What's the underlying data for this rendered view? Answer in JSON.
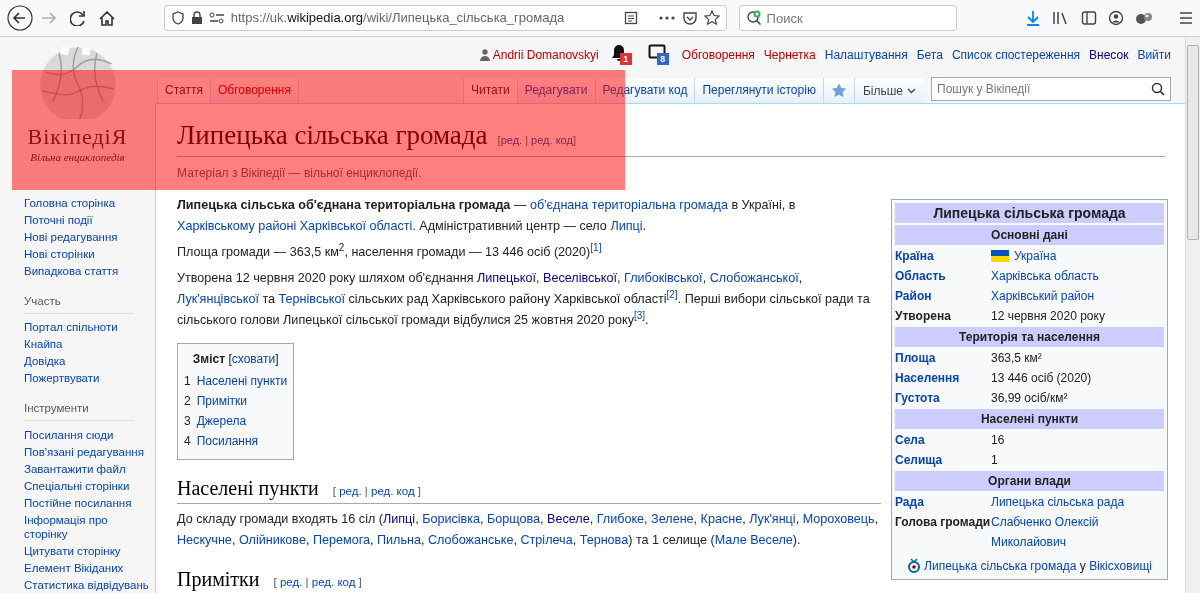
{
  "annotation": {
    "kind": "highlight"
  },
  "browser": {
    "nav": [
      {
        "kind": "back",
        "disabled": false
      },
      {
        "kind": "forward",
        "disabled": true
      },
      {
        "kind": "reload",
        "disabled": false
      },
      {
        "kind": "home",
        "disabled": false
      }
    ],
    "url": {
      "prefix": "https://uk.",
      "domain": "wikipedia.org",
      "path": "/wiki/Липецька_сільська_громада"
    },
    "search": {
      "placeholder": "Поиск"
    }
  },
  "user_bar": {
    "user": {
      "text": "Andrii Domanovskyi",
      "kind": "new"
    },
    "notifications": [
      {
        "kind": "bell",
        "badge": "1",
        "color": "#dd3333"
      },
      {
        "kind": "tray",
        "badge": "8",
        "color": "#3366cc"
      }
    ],
    "links": [
      {
        "text": "Обговорення",
        "kind": "new"
      },
      {
        "text": "Чернетка",
        "kind": "new"
      },
      {
        "text": "Налаштування",
        "kind": "link"
      },
      {
        "text": "Бета",
        "kind": "link"
      },
      {
        "text": "Список спостереження",
        "kind": "link"
      },
      {
        "text": "Внесок",
        "kind": "visited"
      },
      {
        "text": "Вийти",
        "kind": "link"
      }
    ]
  },
  "logo": {
    "name": "ВікіпедіЯ",
    "tagline": "Вільна енциклопедія"
  },
  "tabs_left": [
    {
      "label": "Стаття",
      "kind": "link",
      "selected": true
    },
    {
      "label": "Обговорення",
      "kind": "new",
      "selected": false
    }
  ],
  "tabs_right": [
    {
      "label": "Читати",
      "selected": true
    },
    {
      "label": "Редагувати",
      "selected": false
    },
    {
      "label": "Редагувати код",
      "selected": false
    },
    {
      "label": "Переглянути історію",
      "selected": false
    }
  ],
  "watch": {
    "watched": true
  },
  "more": {
    "label": "Більше"
  },
  "wiki_search": {
    "placeholder": "Пошук у Вікіпедії"
  },
  "sidebar": {
    "groups": [
      {
        "items": [
          "Головна сторінка",
          "Поточні події",
          "Нові редагування",
          "Нові сторінки",
          "Випадкова стаття"
        ]
      },
      {
        "heading": "Участь",
        "items": [
          "Портал спільноти",
          "Кнайпа",
          "Довідка",
          "Пожертвувати"
        ]
      },
      {
        "heading": "Інструменти",
        "items": [
          "Посилання сюди",
          "Пов'язані редагування",
          "Завантажити файл",
          "Спеціальні сторінки",
          "Постійне посилання",
          "Інформація про сторінку",
          "Цитувати сторінку",
          "Елемент Вікіданих",
          "Статистика відвідувань"
        ]
      }
    ]
  },
  "article": {
    "title": "Липецька сільська громада",
    "edit_links": [
      {
        "text": "[",
        "kind": "text"
      },
      {
        "text": "ред.",
        "kind": "link"
      },
      {
        "text": " | ",
        "kind": "text"
      },
      {
        "text": "ред. код",
        "kind": "link"
      },
      {
        "text": "]",
        "kind": "text"
      }
    ],
    "subtitle": "Матеріал з Вікіпедії — вільної енциклопедії.",
    "paragraphs": [
      [
        {
          "text": "Липецька сільська об'єднана територіальна громада",
          "kind": "bold"
        },
        {
          "text": " — ",
          "kind": "text"
        },
        {
          "text": "об'єднана територіальна громада",
          "kind": "link"
        },
        {
          "text": " в Україні, в ",
          "kind": "text"
        },
        {
          "text": "Харківському районі Харківської області",
          "kind": "link"
        },
        {
          "text": ". Адміністративний центр — село ",
          "kind": "text"
        },
        {
          "text": "Липці",
          "kind": "link"
        },
        {
          "text": ".",
          "kind": "text"
        }
      ],
      [
        {
          "text": "Площа громади — 363,5 км",
          "kind": "text"
        },
        {
          "text": "2",
          "kind": "sup"
        },
        {
          "text": ", населення громади — 13 446 осіб (2020)",
          "kind": "text"
        },
        {
          "text": "[1]",
          "kind": "ref"
        }
      ],
      [
        {
          "text": "Утворена 12 червня 2020 року шляхом об'єднання ",
          "kind": "text"
        },
        {
          "text": "Липецької",
          "kind": "visited"
        },
        {
          "text": ", ",
          "kind": "text"
        },
        {
          "text": "Веселівської",
          "kind": "visited"
        },
        {
          "text": ", ",
          "kind": "text"
        },
        {
          "text": "Глибоківської",
          "kind": "link"
        },
        {
          "text": ", ",
          "kind": "text"
        },
        {
          "text": "Слобожанської",
          "kind": "link"
        },
        {
          "text": ", ",
          "kind": "text"
        },
        {
          "text": "Лук'янцівської",
          "kind": "link"
        },
        {
          "text": " та ",
          "kind": "text"
        },
        {
          "text": "Тернівської",
          "kind": "link"
        },
        {
          "text": " сільських рад Харківського району Харківської області",
          "kind": "text"
        },
        {
          "text": "[2]",
          "kind": "ref"
        },
        {
          "text": ". Перші вибори сільської ради та сільського голови Липецької сільської громади відбулися 25 жовтня 2020 року",
          "kind": "text"
        },
        {
          "text": "[3]",
          "kind": "ref"
        },
        {
          "text": ".",
          "kind": "text"
        }
      ]
    ],
    "toc": {
      "title": [
        {
          "text": "Зміст",
          "kind": "bold"
        },
        {
          "text": " [",
          "kind": "text"
        },
        {
          "text": "сховати",
          "kind": "link"
        },
        {
          "text": "]",
          "kind": "text"
        }
      ],
      "items": [
        {
          "number": "1",
          "label": "Населені пункти"
        },
        {
          "number": "2",
          "label": "Примітки"
        },
        {
          "number": "3",
          "label": "Джерела"
        },
        {
          "number": "4",
          "label": "Посилання"
        }
      ]
    },
    "sections": [
      {
        "heading": "Населені пункти",
        "edit_links": [
          {
            "text": "[ ",
            "kind": "text"
          },
          {
            "text": "ред.",
            "kind": "link"
          },
          {
            "text": " | ",
            "kind": "text"
          },
          {
            "text": "ред. код",
            "kind": "link"
          },
          {
            "text": " ]",
            "kind": "text"
          }
        ],
        "paragraphs": [
          [
            {
              "text": "До складу громади входять 16 сіл (",
              "kind": "text"
            },
            {
              "text": "Липці",
              "kind": "visited"
            },
            {
              "text": ", ",
              "kind": "text"
            },
            {
              "text": "Борисівка",
              "kind": "link"
            },
            {
              "text": ", ",
              "kind": "text"
            },
            {
              "text": "Борщова",
              "kind": "link"
            },
            {
              "text": ", ",
              "kind": "text"
            },
            {
              "text": "Веселе",
              "kind": "visited"
            },
            {
              "text": ", ",
              "kind": "text"
            },
            {
              "text": "Глибоке",
              "kind": "link"
            },
            {
              "text": ", ",
              "kind": "text"
            },
            {
              "text": "Зелене",
              "kind": "link"
            },
            {
              "text": ", ",
              "kind": "text"
            },
            {
              "text": "Красне",
              "kind": "link"
            },
            {
              "text": ", ",
              "kind": "text"
            },
            {
              "text": "Лук'янці",
              "kind": "link"
            },
            {
              "text": ", ",
              "kind": "text"
            },
            {
              "text": "Мороховець",
              "kind": "link"
            },
            {
              "text": ", ",
              "kind": "text"
            },
            {
              "text": "Нескучне",
              "kind": "link"
            },
            {
              "text": ", ",
              "kind": "text"
            },
            {
              "text": "Олійникове",
              "kind": "link"
            },
            {
              "text": ", ",
              "kind": "text"
            },
            {
              "text": "Перемога",
              "kind": "link"
            },
            {
              "text": ", ",
              "kind": "text"
            },
            {
              "text": "Пильна",
              "kind": "link"
            },
            {
              "text": ", ",
              "kind": "text"
            },
            {
              "text": "Слобожанське",
              "kind": "link"
            },
            {
              "text": ", ",
              "kind": "text"
            },
            {
              "text": "Стрілеча",
              "kind": "link"
            },
            {
              "text": ", ",
              "kind": "text"
            },
            {
              "text": "Тернова",
              "kind": "link"
            },
            {
              "text": ") та 1 селище (",
              "kind": "text"
            },
            {
              "text": "Мале Веселе",
              "kind": "link"
            },
            {
              "text": ").",
              "kind": "text"
            }
          ]
        ]
      },
      {
        "heading": "Примітки",
        "edit_links": [
          {
            "text": "[ ",
            "kind": "text"
          },
          {
            "text": "ред.",
            "kind": "link"
          },
          {
            "text": " | ",
            "kind": "text"
          },
          {
            "text": "ред. код",
            "kind": "link"
          },
          {
            "text": " ]",
            "kind": "text"
          }
        ]
      }
    ]
  },
  "infobox": {
    "title": "Липецька сільська громада",
    "sections": [
      {
        "heading": "Основні дані",
        "rows": [
          {
            "kind": "flag",
            "label": {
              "text": "Країна",
              "kind": "link"
            },
            "value": [
              {
                "text": "Україна",
                "kind": "link"
              }
            ]
          },
          {
            "kind": "plain",
            "label": {
              "text": "Область",
              "kind": "link"
            },
            "value": [
              {
                "text": "Харківська область",
                "kind": "link"
              }
            ]
          },
          {
            "kind": "plain",
            "label": {
              "text": "Район",
              "kind": "link"
            },
            "value": [
              {
                "text": "Харківський район",
                "kind": "link"
              }
            ]
          },
          {
            "kind": "plain",
            "label": {
              "text": "Утворена",
              "kind": "text"
            },
            "value": [
              {
                "text": "12 червня 2020 року",
                "kind": "text"
              }
            ]
          }
        ]
      },
      {
        "heading": "Територія та населення",
        "rows": [
          {
            "kind": "plain",
            "label": {
              "text": "Площа",
              "kind": "link"
            },
            "value": [
              {
                "text": "363,5 км²",
                "kind": "text"
              }
            ]
          },
          {
            "kind": "plain",
            "label": {
              "text": "Населення",
              "kind": "link"
            },
            "value": [
              {
                "text": "13 446 осіб (2020)",
                "kind": "text"
              }
            ]
          },
          {
            "kind": "plain",
            "label": {
              "text": "Густота",
              "kind": "link"
            },
            "value": [
              {
                "text": "36,99 осіб/км²",
                "kind": "text"
              }
            ]
          }
        ]
      },
      {
        "heading": "Населені пункти",
        "rows": [
          {
            "kind": "plain",
            "label": {
              "text": "Села",
              "kind": "link"
            },
            "value": [
              {
                "text": "16",
                "kind": "text"
              }
            ]
          },
          {
            "kind": "plain",
            "label": {
              "text": "Селища",
              "kind": "link"
            },
            "value": [
              {
                "text": "1",
                "kind": "text"
              }
            ]
          }
        ]
      },
      {
        "heading": "Органи влади",
        "rows": [
          {
            "kind": "plain",
            "label": {
              "text": "Рада",
              "kind": "link"
            },
            "value": [
              {
                "text": "Липецька сільська рада",
                "kind": "link"
              }
            ]
          },
          {
            "kind": "plain",
            "label": {
              "text": "Голова громади",
              "kind": "text"
            },
            "value": [
              {
                "text": "Слабченко Олексій Миколайович",
                "kind": "link"
              }
            ]
          }
        ]
      }
    ],
    "footer": [
      {
        "text": "Липецька сільська громада",
        "kind": "link"
      },
      {
        "text": " у ",
        "kind": "text"
      },
      {
        "text": "Вікісховищі",
        "kind": "link"
      }
    ]
  }
}
